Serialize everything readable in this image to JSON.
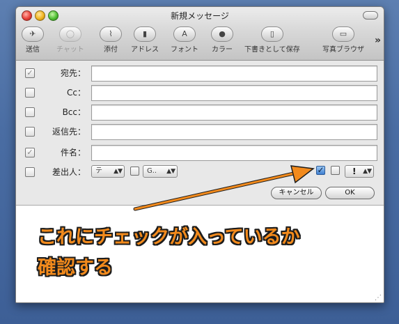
{
  "window": {
    "title": "新規メッセージ"
  },
  "toolbar": {
    "items": [
      {
        "label": "送信",
        "icon": "send-icon",
        "glyph": "✈"
      },
      {
        "label": "チャット",
        "icon": "chat-icon",
        "glyph": "◯"
      },
      {
        "label": "添付",
        "icon": "paperclip-icon",
        "glyph": "⌇"
      },
      {
        "label": "アドレス",
        "icon": "address-book-icon",
        "glyph": "▮"
      },
      {
        "label": "フォント",
        "icon": "font-icon",
        "glyph": "A"
      },
      {
        "label": "カラー",
        "icon": "color-wheel-icon",
        "glyph": "●"
      },
      {
        "label": "下書きとして保存",
        "icon": "save-draft-icon",
        "glyph": "▯"
      },
      {
        "label": "写真ブラウザ",
        "icon": "photo-browser-icon",
        "glyph": "▭"
      }
    ],
    "overflow_glyph": "»"
  },
  "fields": {
    "to": {
      "label": "宛先：",
      "value": "",
      "checked": true
    },
    "cc": {
      "label": "Cc：",
      "value": "",
      "checked": false
    },
    "bcc": {
      "label": "Bcc：",
      "value": "",
      "checked": false
    },
    "reply_to": {
      "label": "返信先：",
      "value": "",
      "checked": false
    },
    "subject": {
      "label": "件名：",
      "value": "",
      "checked": true
    },
    "from": {
      "label": "差出人：",
      "value": "テ",
      "checked": false,
      "signature_value": "G.."
    }
  },
  "priority": {
    "value": "!"
  },
  "checkbox_glyph": "✓",
  "buttons": {
    "cancel": "キャンセル",
    "ok": "OK"
  },
  "annotation": {
    "line1": "これにチェックが入っているか",
    "line2": "確認する",
    "color": "#f28a1c"
  }
}
